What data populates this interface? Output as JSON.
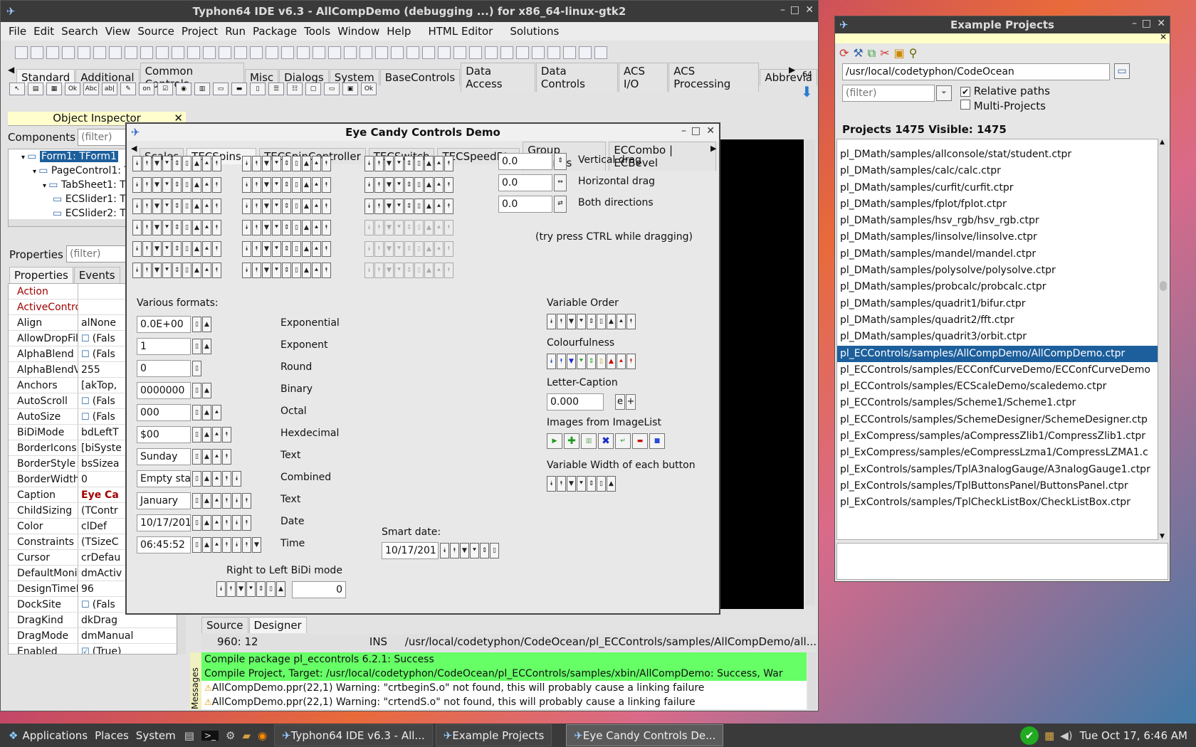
{
  "ide": {
    "title": "Typhon64 IDE v6.3 - AllCompDemo (debugging ...) for x86_64-linux-gtk2",
    "menu": [
      "File",
      "Edit",
      "Search",
      "View",
      "Source",
      "Project",
      "Run",
      "Package",
      "Tools",
      "Window",
      "Help",
      "HTML Editor",
      "Solutions"
    ],
    "palette_tabs": [
      "Standard",
      "Additional",
      "Common Controls",
      "Misc",
      "Dialogs",
      "System",
      "BaseControls",
      "Data Access",
      "Data Controls",
      "ACS I/O",
      "ACS Processing",
      "Abbrevia"
    ],
    "palette_count": "64"
  },
  "object_inspector": {
    "title": "Object Inspector",
    "components_label": "Components",
    "filter_placeholder": "(filter)",
    "tree": [
      "Form1: TForm1",
      "PageControl1: T",
      "TabSheet1: T",
      "ECSlider1: T",
      "ECSlider2: T"
    ],
    "properties_label": "Properties",
    "tabs": [
      "Properties",
      "Events"
    ],
    "rows": [
      {
        "name": "Action",
        "value": "",
        "color": "#a00000"
      },
      {
        "name": "ActiveContro",
        "value": "",
        "color": "#a00000"
      },
      {
        "name": "Align",
        "value": "alNone",
        "color": ""
      },
      {
        "name": "AllowDropFile",
        "value": "(Fals",
        "color": "",
        "check": true
      },
      {
        "name": "AlphaBlend",
        "value": "(Fals",
        "color": "",
        "check": true
      },
      {
        "name": "AlphaBlendVa",
        "value": "255",
        "color": ""
      },
      {
        "name": "Anchors",
        "value": "[akTop,",
        "color": ""
      },
      {
        "name": "AutoScroll",
        "value": "(Fals",
        "color": "",
        "check": true
      },
      {
        "name": "AutoSize",
        "value": "(Fals",
        "color": "",
        "check": true
      },
      {
        "name": "BiDiMode",
        "value": "bdLeftT",
        "color": ""
      },
      {
        "name": "BorderIcons",
        "value": "[biSyste",
        "color": ""
      },
      {
        "name": "BorderStyle",
        "value": "bsSizea",
        "color": ""
      },
      {
        "name": "BorderWidth",
        "value": "0",
        "color": ""
      },
      {
        "name": "Caption",
        "value": "Eye Ca",
        "color": "",
        "bold": true
      },
      {
        "name": "ChildSizing",
        "value": "(TContr",
        "color": ""
      },
      {
        "name": "Color",
        "value": "clDef",
        "color": ""
      },
      {
        "name": "Constraints",
        "value": "(TSizeC",
        "color": ""
      },
      {
        "name": "Cursor",
        "value": "crDefau",
        "color": ""
      },
      {
        "name": "DefaultMonit",
        "value": "dmActiv",
        "color": ""
      },
      {
        "name": "DesignTimeP",
        "value": "96",
        "color": ""
      },
      {
        "name": "DockSite",
        "value": "(Fals",
        "color": "",
        "check": true
      },
      {
        "name": "DragKind",
        "value": "dkDrag",
        "color": ""
      },
      {
        "name": "DragMode",
        "value": "dmManual",
        "color": ""
      },
      {
        "name": "Enabled",
        "value": "(True)",
        "color": "",
        "checked": true
      }
    ]
  },
  "editor": {
    "tabs": [
      "Source",
      "Designer"
    ],
    "status_pos": "960:  12",
    "status_mode": "INS",
    "status_path": "/usr/local/codetyphon/CodeOcean/pl_ECControls/samples/AllCompDemo/all...",
    "messages_label": "Messages",
    "messages": [
      {
        "text": "Compile package pl_eccontrols 6.2.1: Success",
        "ok": true
      },
      {
        "text": "Compile Project, Target: /usr/local/codetyphon/CodeOcean/pl_ECControls/samples/xbin/AllCompDemo: Success, War",
        "ok": true
      },
      {
        "text": "AllCompDemo.ppr(22,1) Warning: \"crtbeginS.o\" not found, this will probably cause a linking failure",
        "ok": false
      },
      {
        "text": "AllCompDemo.ppr(22,1) Warning: \"crtendS.o\" not found, this will probably cause a linking failure",
        "ok": false
      }
    ]
  },
  "demo": {
    "title": "Eye Candy Controls Demo",
    "tabs": [
      "Scales",
      "TECSpins...",
      "TECSpinController",
      "TECSwitch",
      "TECSpeedBtn",
      "Group Controls",
      "ECCombo | ECBevel"
    ],
    "drag_fields": [
      {
        "value": "0.0",
        "label": "Vertical drag"
      },
      {
        "value": "0.0",
        "label": "Horizontal drag"
      },
      {
        "value": "0.0",
        "label": "Both directions"
      }
    ],
    "ctrl_hint": "(try press CTRL while dragging)",
    "various_label": "Various formats:",
    "formats": [
      {
        "value": "0.0E+00",
        "label": "Exponential"
      },
      {
        "value": "1",
        "label": "Exponent"
      },
      {
        "value": "0",
        "label": "Round"
      },
      {
        "value": "0000000",
        "label": "Binary"
      },
      {
        "value": "000",
        "label": "Octal"
      },
      {
        "value": "$00",
        "label": "Hexdecimal"
      },
      {
        "value": "Sunday",
        "label": "Text"
      },
      {
        "value": "Empty sta",
        "label": "Combined"
      },
      {
        "value": "January",
        "label": "Text"
      },
      {
        "value": "10/17/201",
        "label": "Date"
      },
      {
        "value": "06:45:52",
        "label": "Time"
      }
    ],
    "rtl_label": "Right to Left BiDi mode",
    "rtl_value": "0",
    "smart_date_label": "Smart date:",
    "smart_date_value": "10/17/201",
    "variable_order": "Variable Order",
    "colourfulness": "Colourfulness",
    "letter_caption": "Letter-Caption",
    "letter_value": "0.000",
    "letter_e": "e",
    "letter_plus": "+",
    "images_label": "Images from ImageList",
    "variable_width": "Variable Width of each button"
  },
  "examples": {
    "title": "Example Projects",
    "path": "/usr/local/codetyphon/CodeOcean",
    "filter_placeholder": "(filter)",
    "relative_paths": "Relative paths",
    "multi_projects": "Multi-Projects",
    "counts": "Projects 1475  Visible: 1475",
    "items": [
      "pl_DMath/samples/allconsole/stat/student.ctpr",
      "pl_DMath/samples/calc/calc.ctpr",
      "pl_DMath/samples/curfit/curfit.ctpr",
      "pl_DMath/samples/fplot/fplot.ctpr",
      "pl_DMath/samples/hsv_rgb/hsv_rgb.ctpr",
      "pl_DMath/samples/linsolve/linsolve.ctpr",
      "pl_DMath/samples/mandel/mandel.ctpr",
      "pl_DMath/samples/polysolve/polysolve.ctpr",
      "pl_DMath/samples/probcalc/probcalc.ctpr",
      "pl_DMath/samples/quadrit1/bifur.ctpr",
      "pl_DMath/samples/quadrit2/fft.ctpr",
      "pl_DMath/samples/quadrit3/orbit.ctpr",
      "pl_ECControls/samples/AllCompDemo/AllCompDemo.ctpr",
      "pl_ECControls/samples/ECConfCurveDemo/ECConfCurveDemo",
      "pl_ECControls/samples/ECScaleDemo/scaledemo.ctpr",
      "pl_ECControls/samples/Scheme1/Scheme1.ctpr",
      "pl_ECControls/samples/SchemeDesigner/SchemeDesigner.ctp",
      "pl_ExCompress/samples/aCompressZlib1/CompressZlib1.ctpr",
      "pl_ExCompress/samples/eCompressLzma1/CompressLZMA1.c",
      "pl_ExControls/samples/TplA3nalogGauge/A3nalogGauge1.ctpr",
      "pl_ExControls/samples/TplButtonsPanel/ButtonsPanel.ctpr",
      "pl_ExControls/samples/TplCheckListBox/CheckListBox.ctpr"
    ],
    "selected_index": 12
  },
  "taskbar": {
    "applications": "Applications",
    "places": "Places",
    "system": "System",
    "tasks": [
      "Typhon64 IDE v6.3 - All...",
      "Example Projects",
      "Eye Candy Controls De..."
    ],
    "active_task": 2,
    "clock": "Tue Oct 17,  6:46 AM"
  },
  "colors": {
    "accent": "#1c5f9c",
    "success": "#66ff66",
    "warn_red": "#a00000",
    "titlebar": "#3c3c3c"
  }
}
